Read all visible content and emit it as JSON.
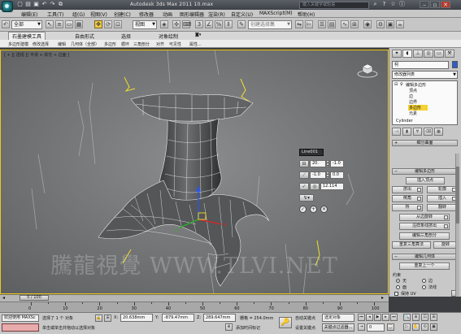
{
  "app": {
    "title": "Autodesk 3ds Max   2011      10.max",
    "search_placeholder": "键入关键字或短语"
  },
  "menu": [
    "编辑(E)",
    "工具(T)",
    "组(G)",
    "视图(V)",
    "创建(C)",
    "修改器",
    "动画",
    "图形编辑器",
    "渲染(R)",
    "自定义(U)",
    "MAXScript(M)",
    "帮助(H)"
  ],
  "toolbar": {
    "filter_value": "全部",
    "coord_value": "视图",
    "named_set_placeholder": "创建选择集"
  },
  "ribbon": {
    "tabs": [
      "石墨建模工具",
      "自由形式",
      "选择",
      "对象绘制"
    ],
    "subitems": [
      "多边形建模",
      "修改选择",
      "编辑",
      "几何体（全部）",
      "多边形",
      "循环",
      "三角剖分",
      "对齐",
      "可见性",
      "属性..."
    ]
  },
  "viewport": {
    "label": "[ + ][ 透视 ][ 平滑 + 高光 + 边面 ]",
    "watermark": "騰龍視覺 WWW.TLVI.NET"
  },
  "caddy": {
    "title": "Line001",
    "row1_value": "20.",
    "row1b_value": "-1.0",
    "row2_value": "-1.0",
    "row2b_value": "0.0",
    "row3_value": "12.114"
  },
  "command_panel": {
    "object_name": "柯",
    "modifier_list": "修改器列表",
    "stack": [
      "编辑多边形",
      "顶点",
      "边",
      "边界",
      "多边形",
      "元素",
      "Cylinder"
    ],
    "selected_index": 4,
    "rollout_subdiv": "细分曲面",
    "rollout_edit_poly": "编辑多边形",
    "insert_vertex": "插入顶点",
    "ops": [
      [
        "挤出",
        "轮廓"
      ],
      [
        "倒角",
        "插入"
      ],
      [
        "桥",
        "翻转"
      ]
    ],
    "hinge": "从边旋转",
    "spline_extrude": "沿样条线挤出",
    "edit_tri": "编辑三角剖分",
    "retri": "重复三角算法",
    "turn": "旋转",
    "rollout_edit_geo": "编辑几何体",
    "repeat_last": "重复上一个",
    "constraint_label": "约束",
    "constraints": [
      "无",
      "边",
      "面",
      "法线"
    ],
    "preserve_uv": "保持 UV"
  },
  "time": {
    "slider_label": "0 / 100",
    "ticks": [
      0,
      10,
      20,
      30,
      40,
      50,
      60,
      70,
      80,
      90,
      100
    ]
  },
  "status": {
    "script_label": "欢迎使用 MAXSc",
    "selected_text": "选择了 1 个 对象",
    "prompt_text": "单击或单击并拖动以选择对象",
    "x_label": "X:",
    "x_value": "20.638mm",
    "y_label": "Y:",
    "y_value": "-879.47mm",
    "z_label": "Z:",
    "z_value": "289.647mm",
    "grid_text": "栅格 = 254.0mm",
    "add_time_tag": "添加时间标记",
    "auto_key": "自动关键点",
    "set_key": "设置关键点",
    "selected_obj": "选定对象",
    "key_filters": "关键点过滤器...",
    "frame_value": "0"
  },
  "colors": {
    "accent": "#f0c814",
    "selected_stack": "#f6d232",
    "viewport_bg": "#7a7b7d",
    "auto_key": "#c4332a"
  }
}
